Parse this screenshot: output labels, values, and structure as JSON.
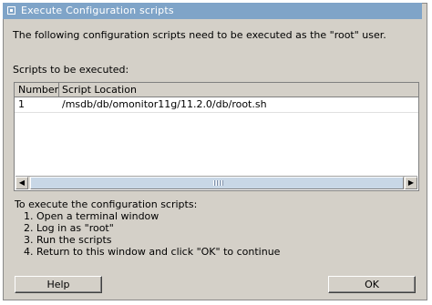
{
  "window": {
    "title": "Execute Configuration scripts",
    "message": "The following configuration scripts need to be executed as the \"root\" user."
  },
  "scripts": {
    "label": "Scripts to be executed:",
    "columns": [
      "Number",
      "Script Location"
    ],
    "rows": [
      {
        "number": "1",
        "location": "/msdb/db/omonitor11g/11.2.0/db/root.sh"
      }
    ]
  },
  "instructions": {
    "heading": "To execute the configuration scripts:",
    "steps": [
      "1.  Open a terminal window",
      "2.  Log in as \"root\"",
      "3.  Run the scripts",
      "4.  Return to this window and click \"OK\" to continue"
    ]
  },
  "buttons": {
    "help": "Help",
    "ok": "OK"
  },
  "colors": {
    "titlebar": "#7fa4c8",
    "dialog_bg": "#d4d0c8"
  }
}
